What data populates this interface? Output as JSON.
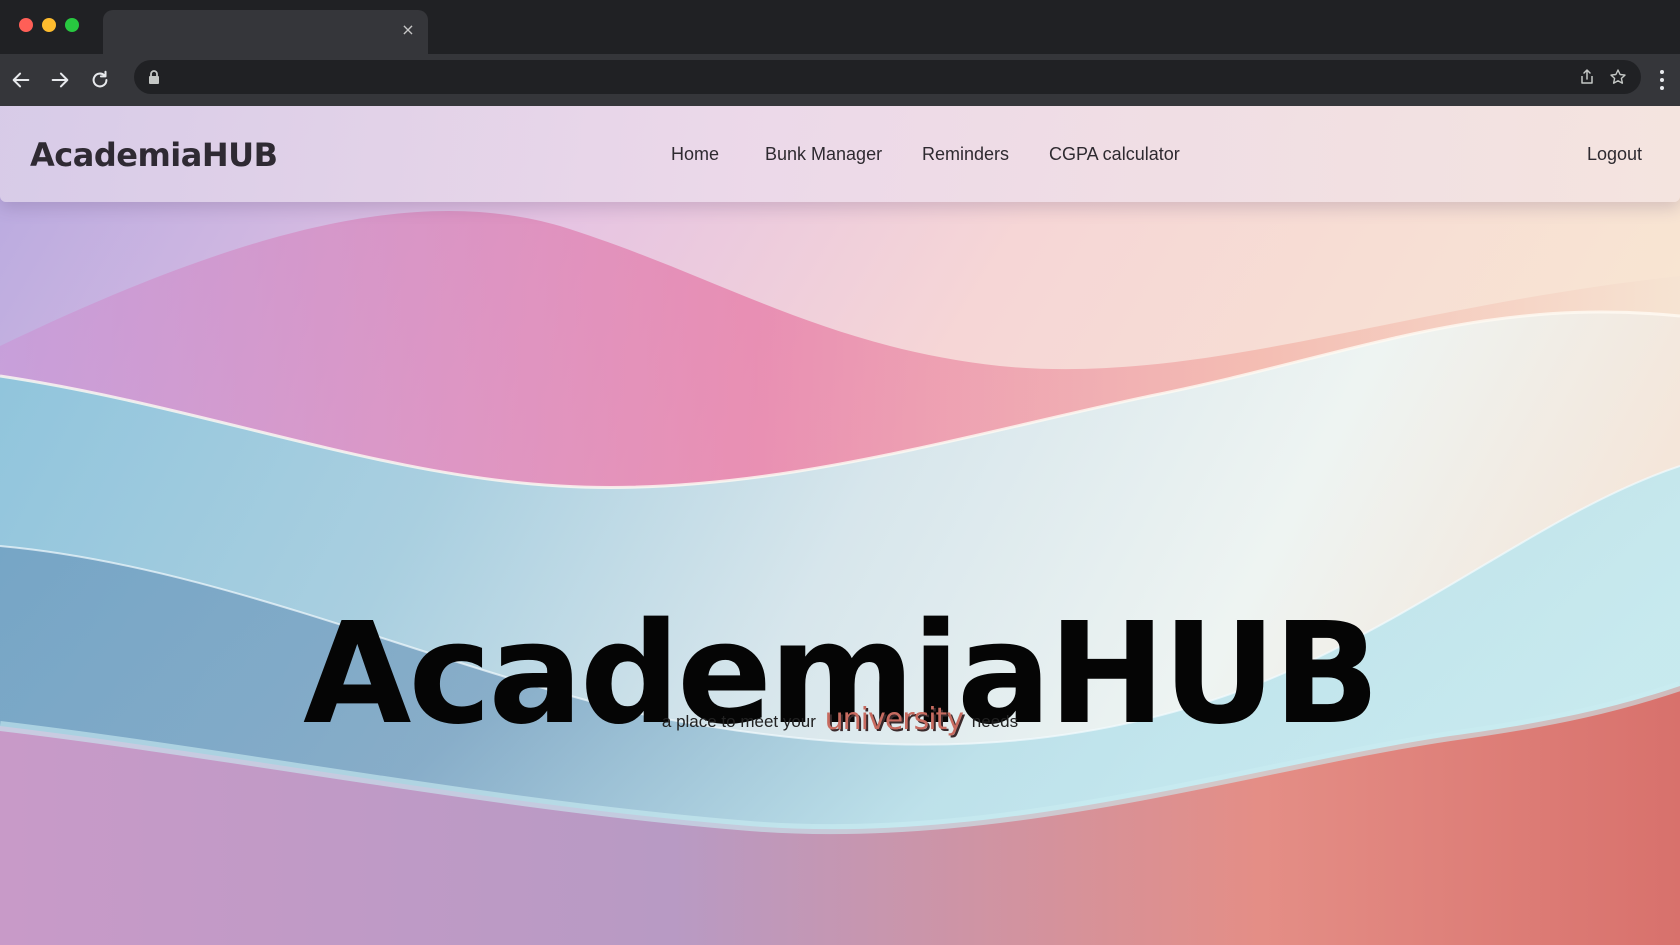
{
  "browser": {
    "tab_close": "×"
  },
  "navbar": {
    "brand": "AcademiaHUB",
    "links": [
      "Home",
      "Bunk Manager",
      "Reminders",
      "CGPA calculator"
    ],
    "logout": "Logout"
  },
  "hero": {
    "title": "AcademiaHUB",
    "tagline_before": "a place to meet your",
    "tagline_highlight": "university",
    "tagline_after": "needs"
  },
  "colors": {
    "brand_text": "#2f2a33",
    "highlight": "#c76b60",
    "chrome_dark": "#202124",
    "chrome_toolbar": "#35363a"
  }
}
